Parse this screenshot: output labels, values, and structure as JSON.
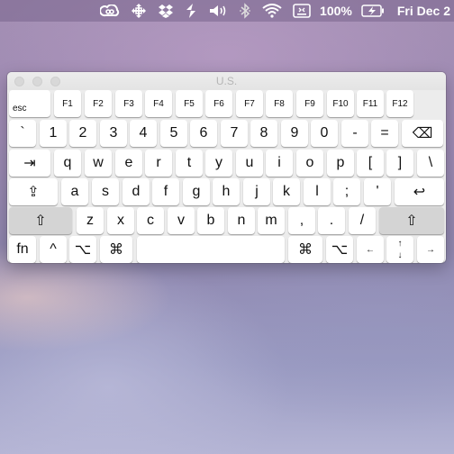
{
  "menubar": {
    "icons": [
      "creative-cloud-icon",
      "move-arrows-icon",
      "dropbox-icon",
      "flux-icon",
      "volume-icon",
      "bluetooth-icon",
      "wifi-icon",
      "keyboard-viewer-icon",
      "battery-icon"
    ],
    "battery_percent": "100%",
    "clock": "Fri Dec 2"
  },
  "window": {
    "title": "U.S."
  },
  "keyboard": {
    "row_fn": [
      "esc",
      "F1",
      "F2",
      "F3",
      "F4",
      "F5",
      "F6",
      "F7",
      "F8",
      "F9",
      "F10",
      "F11",
      "F12"
    ],
    "row_num": [
      "`",
      "1",
      "2",
      "3",
      "4",
      "5",
      "6",
      "7",
      "8",
      "9",
      "0",
      "-",
      "=",
      "⌫"
    ],
    "row_tab": [
      "⇥",
      "q",
      "w",
      "e",
      "r",
      "t",
      "y",
      "u",
      "i",
      "o",
      "p",
      "[",
      "]",
      "\\"
    ],
    "row_home": [
      "⇪",
      "a",
      "s",
      "d",
      "f",
      "g",
      "h",
      "j",
      "k",
      "l",
      ";",
      "'",
      "↩"
    ],
    "row_shift": [
      "⇧",
      "z",
      "x",
      "c",
      "v",
      "b",
      "n",
      "m",
      ",",
      ".",
      "/",
      "⇧"
    ],
    "row_bottom": [
      "fn",
      "^",
      "⌥",
      "⌘",
      "",
      "⌘",
      "⌥",
      "←",
      "↑",
      "↓",
      "→"
    ]
  }
}
